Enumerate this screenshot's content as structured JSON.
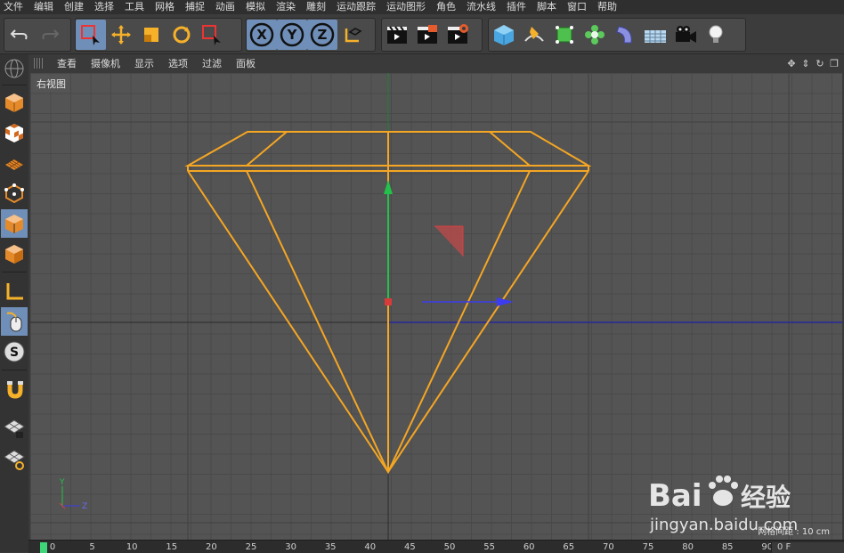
{
  "menubar": {
    "items": [
      "文件",
      "编辑",
      "创建",
      "选择",
      "工具",
      "网格",
      "捕捉",
      "动画",
      "模拟",
      "渲染",
      "雕刻",
      "运动跟踪",
      "运动图形",
      "角色",
      "流水线",
      "插件",
      "脚本",
      "窗口",
      "帮助"
    ]
  },
  "toolbar": {
    "axis_x": "X",
    "axis_y": "Y",
    "axis_z": "Z"
  },
  "view_menu": {
    "items": [
      "查看",
      "摄像机",
      "显示",
      "选项",
      "过滤",
      "面板"
    ]
  },
  "viewport": {
    "label": "右视图",
    "grid_spacing_text": "网格间距 : 10 cm",
    "mini_axis": {
      "y": "Y",
      "z": "Z"
    }
  },
  "timeline": {
    "ticks": [
      "0",
      "5",
      "10",
      "15",
      "20",
      "25",
      "30",
      "35",
      "40",
      "45",
      "50",
      "55",
      "60",
      "65",
      "70",
      "75",
      "80",
      "85",
      "90"
    ],
    "current_frame": "0",
    "frame_field": "0 F"
  },
  "watermark": {
    "brand": "Bai",
    "brand_suffix": "经验",
    "url": "jingyan.baidu.com"
  },
  "colors": {
    "selection_orange": "#f5a623",
    "axis_green": "#22c24a",
    "axis_blue": "#3c3cf0",
    "axis_red": "#d94040",
    "active_button": "#6f8fb8"
  }
}
